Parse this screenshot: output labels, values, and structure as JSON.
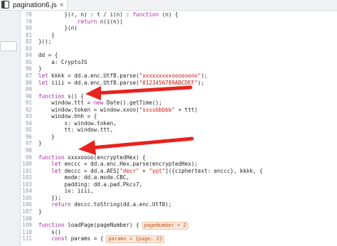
{
  "tab": {
    "title": "pagination6.js",
    "close_label": "×"
  },
  "colors": {
    "keyword": "#a626a4",
    "string": "#c41a16",
    "arrow": "#e8221d",
    "badge_bg": "#fde8dc"
  },
  "lines": [
    {
      "n": "78",
      "t": "        }(r, n) : t / i(n) : function (n) {"
    },
    {
      "n": "79",
      "t": "            return n(i(n))"
    },
    {
      "n": "80",
      "t": "        }(n)"
    },
    {
      "n": "81",
      "t": "    }"
    },
    {
      "n": "82",
      "t": "}();"
    },
    {
      "n": "83",
      "t": ""
    },
    {
      "n": "84",
      "t": "dd = {"
    },
    {
      "n": "85",
      "t": "    a: CryptoJS"
    },
    {
      "n": "86",
      "t": "}"
    },
    {
      "n": "87",
      "t": "let kkkk = dd.a.enc.Utf8.parse(\"xxxxxxxxxoooooooo\");"
    },
    {
      "n": "88",
      "t": "let iiii = dd.a.enc.Utf8.parse(\"0123456789ABCDEF\");"
    },
    {
      "n": "89",
      "t": ""
    },
    {
      "n": "90",
      "t": "function s() {"
    },
    {
      "n": "91",
      "t": "    window.ttt = new Date().getTime();"
    },
    {
      "n": "92",
      "t": "    window.token = window.xxoo(\"ssssbbbbb\" + ttt)"
    },
    {
      "n": "93",
      "t": "    window.hhh = {"
    },
    {
      "n": "94",
      "t": "        s: window.token,"
    },
    {
      "n": "95",
      "t": "        tt: window.ttt,"
    },
    {
      "n": "96",
      "t": "    }"
    },
    {
      "n": "97",
      "t": "}"
    },
    {
      "n": "98",
      "t": ""
    },
    {
      "n": "99",
      "t": "function xxxxoooo(encryptedHex) {"
    },
    {
      "n": "100",
      "t": "    let enccc = dd.a.enc.Hex.parse(encryptedHex);"
    },
    {
      "n": "101",
      "t": "    let deccc = dd.a.AES[\"decr\" + \"ypt\"]({ciphertext: enccc}, kkkk, {"
    },
    {
      "n": "102",
      "t": "        mode: dd.a.mode.CBC,"
    },
    {
      "n": "103",
      "t": "        padding: dd.a.pad.Pkcs7,"
    },
    {
      "n": "104",
      "t": "        iv: iiii,"
    },
    {
      "n": "105",
      "t": "    });"
    },
    {
      "n": "106",
      "t": "    return deccc.toString(dd.a.enc.Utf8);"
    },
    {
      "n": "107",
      "t": "}"
    },
    {
      "n": "108",
      "t": ""
    },
    {
      "n": "109",
      "t": "function loadPage(pageNumber) {",
      "badge": "pageNumber = 2"
    },
    {
      "n": "110",
      "t": "    s()"
    },
    {
      "n": "111",
      "t": "    const params = {",
      "badge": "params = {page: 2}"
    }
  ]
}
